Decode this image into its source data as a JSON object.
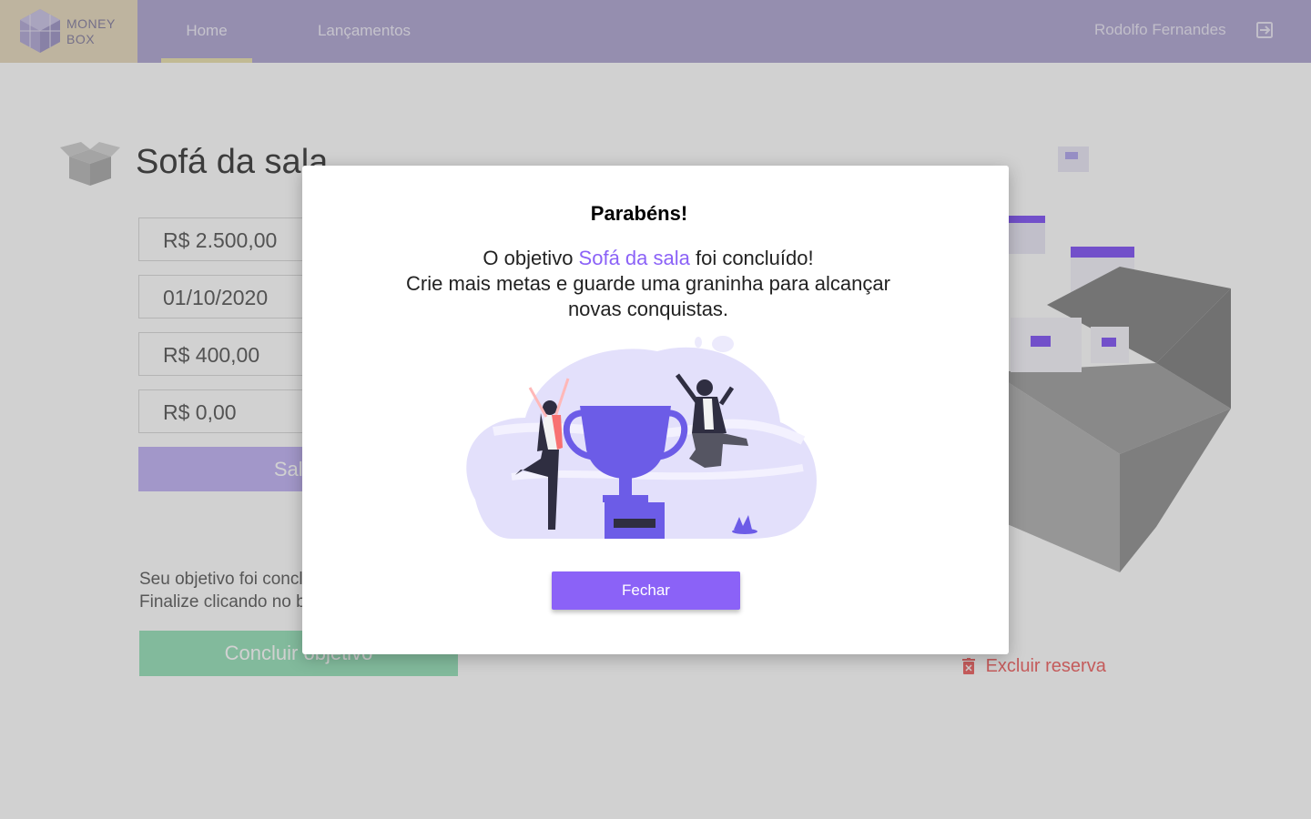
{
  "header": {
    "logo_text_line1": "MONEY",
    "logo_text_line2": "BOX",
    "nav": {
      "home": "Home",
      "lancamentos": "Lançamentos"
    },
    "user_name": "Rodolfo Fernandes"
  },
  "goal": {
    "title": "Sofá da sala",
    "fields": {
      "total": "R$ 2.500,00",
      "date": "01/10/2020",
      "monthly": "R$ 400,00",
      "saved": "R$ 0,00"
    },
    "save_label": "Salvar",
    "done_line1": "Seu objetivo foi concluído!",
    "done_line2": "Finalize clicando no botão abaixo",
    "finish_label": "Concluir objetivo",
    "delete_label": "Excluir reserva"
  },
  "modal": {
    "title": "Parabéns!",
    "text_prefix": "O objetivo ",
    "goal_name": "Sofá da sala",
    "text_suffix": " foi concluído!",
    "text_line2": "Crie mais metas e guarde uma graninha para alcançar novas conquistas.",
    "close_label": "Fechar"
  },
  "colors": {
    "header_bg": "#b6aed6",
    "accent": "#8b62f7",
    "success": "#9fe3bf",
    "danger": "#f07070"
  }
}
